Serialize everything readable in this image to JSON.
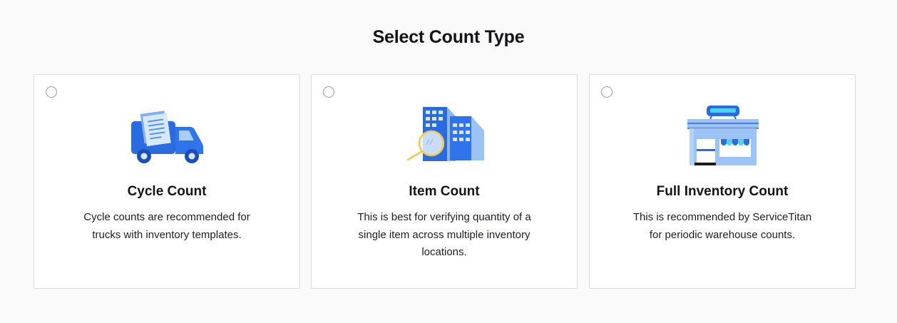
{
  "page": {
    "title": "Select Count Type"
  },
  "cards": [
    {
      "title": "Cycle Count",
      "description": "Cycle counts are recommended for trucks with inventory templates.",
      "icon": "truck-documents-icon",
      "selected": false
    },
    {
      "title": "Item Count",
      "description": "This is best for verifying quantity of a single item across multiple inventory locations.",
      "icon": "buildings-magnifier-icon",
      "selected": false
    },
    {
      "title": "Full Inventory Count",
      "description": "This is recommended by ServiceTitan for periodic warehouse counts.",
      "icon": "warehouse-store-icon",
      "selected": false
    }
  ],
  "colors": {
    "accent_blue": "#2a6bdf",
    "light_blue": "#9cc3f5",
    "magnifier_yellow": "#f2c94c",
    "card_border": "#dcdcdf",
    "background": "#fafafa"
  }
}
